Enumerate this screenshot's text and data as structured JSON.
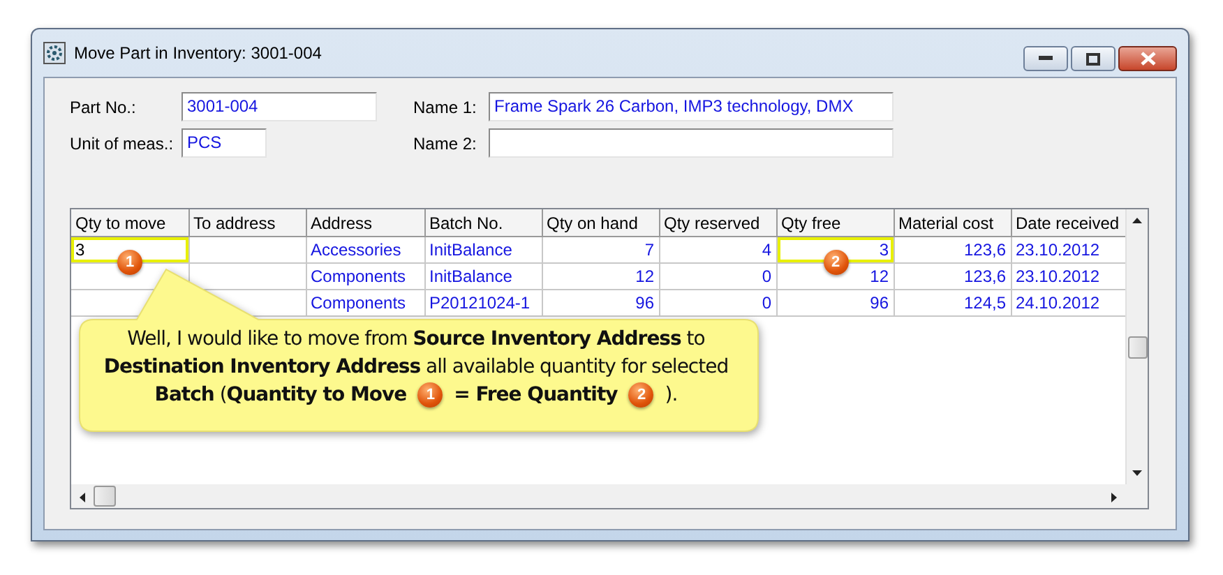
{
  "window": {
    "title": "Move Part in Inventory: 3001-004"
  },
  "fields": [
    {
      "label": "Part No.:",
      "value": "3001-004"
    },
    {
      "label": "Name 1:",
      "value": "Frame Spark 26 Carbon, IMP3 technology, DMX"
    },
    {
      "label": "Unit of meas.:",
      "value": "PCS"
    },
    {
      "label": "Name 2:"
    }
  ],
  "table": {
    "columns": [
      {
        "label": "Qty to move",
        "kind": "input"
      },
      {
        "label": "To address",
        "kind": "text"
      },
      {
        "label": "Address",
        "kind": "text"
      },
      {
        "label": "Batch No.",
        "kind": "text"
      },
      {
        "label": "Qty on hand",
        "kind": "number"
      },
      {
        "label": "Qty reserved",
        "kind": "number"
      },
      {
        "label": "Qty free",
        "kind": "number"
      },
      {
        "label": "Material cost",
        "kind": "number"
      },
      {
        "label": "Date received",
        "kind": "text"
      }
    ],
    "rows": [
      {
        "cells": [
          {
            "text": "3",
            "badge": "1"
          },
          {},
          {
            "text": "Accessories"
          },
          {
            "text": "InitBalance"
          },
          {
            "text": "7"
          },
          {
            "text": "4"
          },
          {
            "text": "3",
            "badge": "2"
          },
          {
            "text": "123,6"
          },
          {
            "text": "23.10.2012"
          }
        ]
      },
      {
        "cells": [
          {},
          {},
          {
            "text": "Components"
          },
          {
            "text": "InitBalance"
          },
          {
            "text": "12"
          },
          {
            "text": "0"
          },
          {
            "text": "12"
          },
          {
            "text": "123,6"
          },
          {
            "text": "23.10.2012"
          }
        ]
      },
      {
        "cells": [
          {},
          {},
          {
            "text": "Components"
          },
          {
            "text": "P20121024-1"
          },
          {
            "text": "96"
          },
          {
            "text": "0"
          },
          {
            "text": "96"
          },
          {
            "text": "124,5"
          },
          {
            "text": "24.10.2012"
          }
        ]
      }
    ]
  },
  "callout": {
    "text": "Well, I would like to move from **Source Inventory Address** to **Destination Inventory Address** all available quantity for selected",
    "last_line": [
      {
        "kind": "text",
        "text": "**Batch** (**Quantity to Move**"
      },
      {
        "kind": "badge",
        "text": "1"
      },
      {
        "kind": "text",
        "text": "**= Free Quantity**"
      },
      {
        "kind": "badge",
        "text": "2"
      },
      {
        "kind": "text",
        "text": ")."
      }
    ]
  }
}
